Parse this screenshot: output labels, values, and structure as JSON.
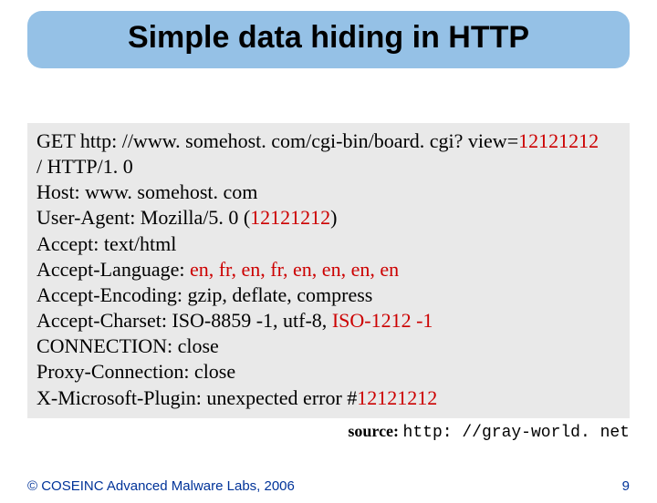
{
  "title": "Simple data hiding in HTTP",
  "http": {
    "line1a": "GET http: //www. somehost. com/cgi-bin/board. cgi? view=",
    "line1b": "12121212",
    "line2": "/ HTTP/1. 0",
    "line3": "Host: www. somehost. com",
    "line4a": "User-Agent: Mozilla/5. 0 (",
    "line4b": "12121212",
    "line4c": ")",
    "line5": "Accept: text/html",
    "line6a": "Accept-Language: ",
    "line6b": "en, fr, en, fr, en, en, en, en",
    "line7": "Accept-Encoding: gzip, deflate, compress",
    "line8a": "Accept-Charset: ISO-8859 -1, utf-8, ",
    "line8b": "ISO-1212 -1",
    "line9": "CONNECTION: close",
    "line10": "Proxy-Connection: close",
    "line11a": "X-Microsoft-Plugin: unexpected error #",
    "line11b": "12121212"
  },
  "source": {
    "label": "source: ",
    "url": "http: //gray-world. net"
  },
  "footer": {
    "copyright": "© COSEINC Advanced Malware Labs, 2006",
    "page": "9"
  }
}
